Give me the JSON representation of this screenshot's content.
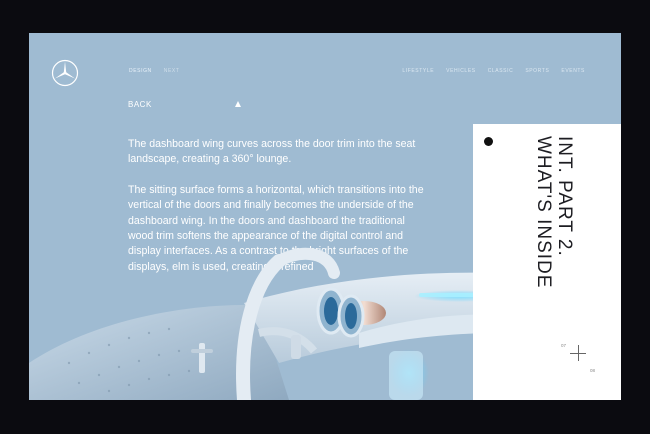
{
  "nav": {
    "left": [
      "DESIGN",
      "NEXT"
    ],
    "right": [
      "LIFESTYLE",
      "VEHICLES",
      "CLASSIC",
      "SPORTS",
      "EVENTS"
    ]
  },
  "back_label": "BACK",
  "paragraphs": [
    "The dashboard wing curves across the door trim into the seat landscape, creating a 360° lounge.",
    "The sitting surface forms a horizontal, which transitions into the vertical of the doors and finally becomes the underside of the dashboard wing. In the doors and dashboard the traditional wood trim softens the appearance of the digital control and display interfaces. As a contrast to the bright surfaces of the displays, elm is used, creating a refined"
  ],
  "card": {
    "title_line1": "INT. PART 2.",
    "title_line2": "WHAT'S INSIDE",
    "page_current": "07",
    "page_total": "08"
  },
  "icons": {
    "logo": "mercedes-star-logo",
    "back": "triangle-up-icon",
    "plus": "plus-icon"
  },
  "colors": {
    "background": "#9fbbd2",
    "frame": "#0b0b10",
    "card": "#ffffff",
    "accent_glow": "#5fd2ff"
  }
}
